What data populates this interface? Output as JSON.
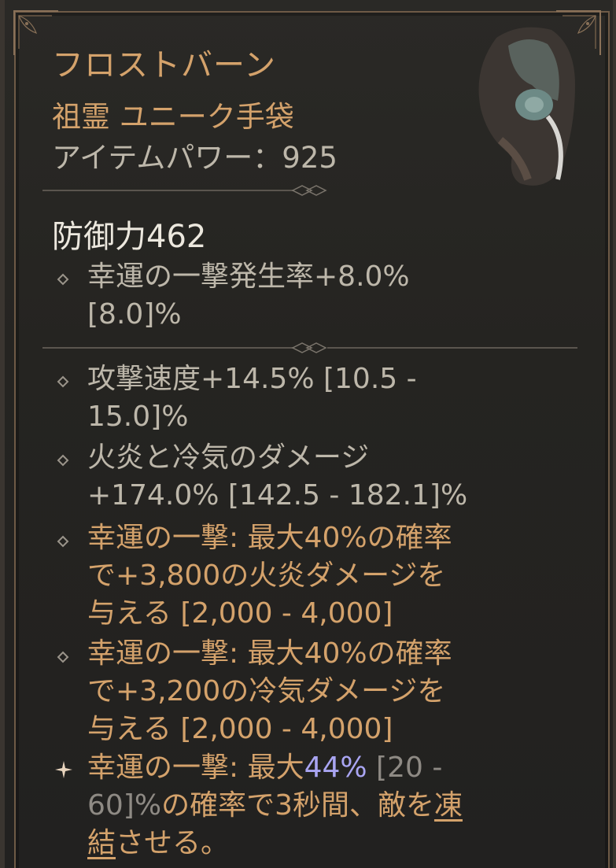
{
  "item": {
    "name": "フロストバーン",
    "type": "祖霊 ユニーク手袋",
    "power": "アイテムパワー：925"
  },
  "defense": "防御力462",
  "implicit": {
    "line1": "幸運の一撃発生率+8.0%",
    "line2": "[8.0]%"
  },
  "affixes": [
    {
      "line1": "攻撃速度+14.5% [10.5 -",
      "line2": "15.0]%"
    },
    {
      "line1": "火炎と冷気のダメージ",
      "line2": "+174.0% [142.5 - 182.1]%"
    }
  ],
  "legendary_affixes": [
    {
      "line1": "幸運の一撃: 最大40%の確率",
      "line2": "で+3,800の火炎ダメージを",
      "line3": "与える [2,000 - 4,000]"
    },
    {
      "line1": "幸運の一撃: 最大40%の確率",
      "line2": "で+3,200の冷気ダメージを",
      "line3": "与える [2,000 - 4,000]"
    }
  ],
  "unique_power": {
    "prefix": "幸運の一撃: 最大",
    "value": "44%",
    "range_a": " [20 -",
    "range_b": "60]%",
    "rest_line2": "の確率で3秒間、敵を",
    "underlined_a": "凍",
    "underlined_b": "結",
    "rest_line3": "させる。"
  },
  "colors": {
    "legendary": "#d4a26b",
    "highlight": "#a9a5f2",
    "text": "#bdb7aa",
    "frame": "#6e5a46"
  },
  "icons": [
    "gloves-item-icon",
    "diamond-bullet-icon",
    "star-bullet-icon",
    "divider-ornament-icon"
  ]
}
